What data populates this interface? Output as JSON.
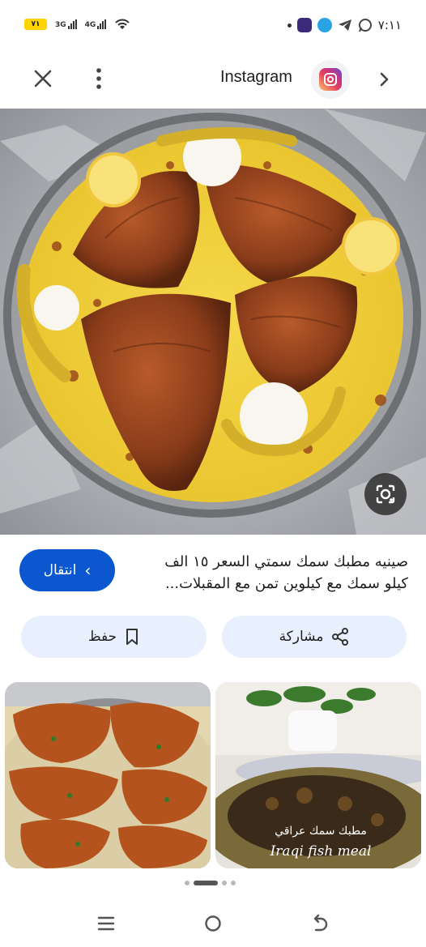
{
  "status_bar": {
    "time": "٧:١١",
    "battery": "٧١",
    "signal_1": "3G",
    "signal_2": "4G"
  },
  "top_bar": {
    "title": "Instagram"
  },
  "result": {
    "caption": "صينيه مطبك سمك سمتي السعر ١٥ الف كيلو سمك مع كيلوين تمن مع المقبلات...",
    "visit_label": "انتقال",
    "share_label": "مشاركة",
    "save_label": "حفظ"
  },
  "related": [
    {
      "overlay_text_1": "",
      "overlay_text_2": ""
    },
    {
      "overlay_text_1": "مطبك سمك عراقي",
      "overlay_text_2": "Iraqi fish meal"
    }
  ],
  "pager": {
    "count": 4,
    "active_index": 1
  },
  "colors": {
    "accent": "#0b57d0",
    "chip_bg": "#e8f0fe"
  },
  "icons": {
    "close": "close-icon",
    "more": "more-vert-icon",
    "next": "chevron-right-icon",
    "lens": "google-lens-icon",
    "share": "share-icon",
    "save": "bookmark-icon"
  }
}
